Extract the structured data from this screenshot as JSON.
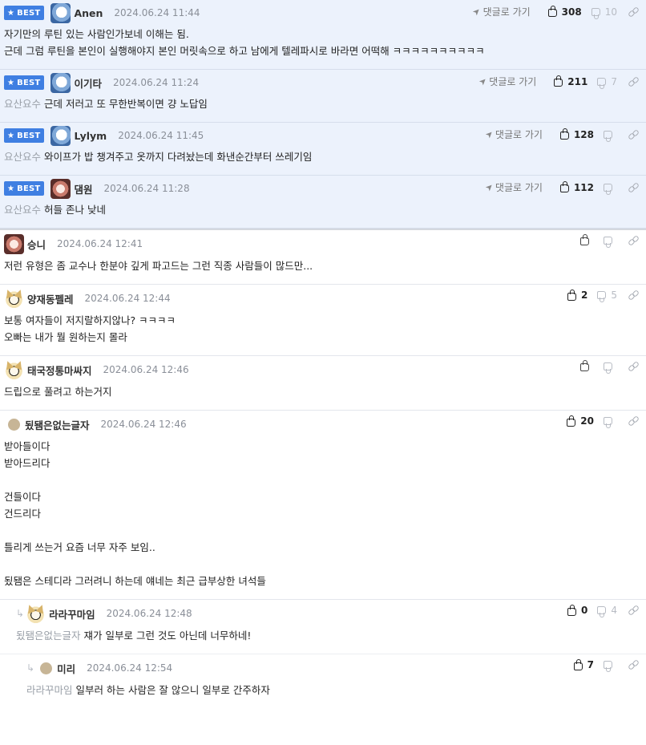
{
  "ui": {
    "best_label": "BEST",
    "goto_label": "댓글로 가기"
  },
  "comments": [
    {
      "best": true,
      "avatar": "ghost-avatar",
      "nick": "Anen",
      "date": "2024.06.24 11:44",
      "up": "308",
      "down": "10",
      "mention": "",
      "lines": [
        "자기만의 루틴 있는 사람인가보네 이해는 됨.",
        "근데 그럼 루틴을 본인이 실행해야지 본인 머릿속으로 하고 남에게 텔레파시로 바라면 어떡해 ㅋㅋㅋㅋㅋㅋㅋㅋㅋㅋ"
      ]
    },
    {
      "best": true,
      "avatar": "ghost-avatar",
      "nick": "이기타",
      "date": "2024.06.24 11:24",
      "up": "211",
      "down": "7",
      "mention": "요산요수",
      "lines": [
        "근데 저러고 또 무한반복이면 걍 노답임"
      ]
    },
    {
      "best": true,
      "avatar": "ghost-avatar",
      "nick": "Lylym",
      "date": "2024.06.24 11:45",
      "up": "128",
      "down": "",
      "mention": "요산요수",
      "lines": [
        "와이프가 밥 챙겨주고 옷까지 다려놨는데 화낸순간부터 쓰레기임"
      ]
    },
    {
      "best": true,
      "avatar": "dog-avatar",
      "nick": "댐원",
      "date": "2024.06.24 11:28",
      "up": "112",
      "down": "",
      "mention": "요산요수",
      "lines": [
        "허들 존나 낮네"
      ]
    },
    {
      "best": false,
      "avatar": "dog-avatar",
      "nick": "승니",
      "date": "2024.06.24 12:41",
      "up": "",
      "down": "",
      "mention": "",
      "lines": [
        "저런 유형은 좀 교수나 한분야 깊게 파고드는 그런 직종 사람들이 많드만..."
      ]
    },
    {
      "best": false,
      "avatar": "fox-avatar",
      "nick": "양재동펠레",
      "date": "2024.06.24 12:44",
      "up": "2",
      "down": "5",
      "mention": "",
      "lines": [
        "보통 여자들이 저지랄하지않나? ㅋㅋㅋㅋ",
        "오빠는 내가 뭘 원하는지 몰라"
      ]
    },
    {
      "best": false,
      "avatar": "fox-avatar",
      "nick": "태국정통마싸지",
      "date": "2024.06.24 12:46",
      "up": "",
      "down": "",
      "mention": "",
      "lines": [
        "드립으로 풀려고 하는거지"
      ]
    },
    {
      "best": false,
      "avatar": "dot-avatar",
      "nick": "됬됌은없는글자",
      "date": "2024.06.24 12:46",
      "up": "20",
      "down": "",
      "mention": "",
      "lines": [
        "받아들이다",
        "받아드리다",
        "",
        "건들이다",
        "건드리다",
        "",
        "틀리게 쓰는거 요즘 너무 자주 보임..",
        "",
        "됬됌은 스테디라 그러려니 하는데 얘네는 최근 급부상한 녀석들"
      ]
    },
    {
      "best": false,
      "reply_level": 1,
      "avatar": "fox-avatar",
      "nick": "라라꾸마임",
      "date": "2024.06.24 12:48",
      "up": "0",
      "down": "4",
      "mention": "됬됌은없는글자",
      "lines": [
        "쟤가 일부로 그런 것도 아닌데 너무하네!"
      ]
    },
    {
      "best": false,
      "reply_level": 2,
      "avatar": "dot-avatar",
      "nick": "미리",
      "date": "2024.06.24 12:54",
      "up": "7",
      "down": "",
      "mention": "라라꾸마임",
      "lines": [
        "일부러 하는 사람은 잘 않으니 일부로 간주하자"
      ]
    }
  ]
}
